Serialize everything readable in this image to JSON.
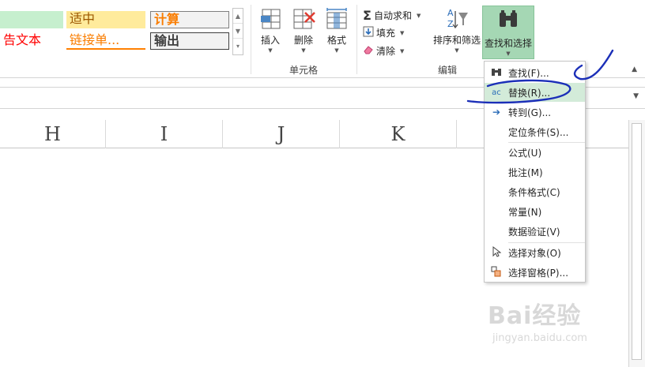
{
  "styles": {
    "neutral": "适中",
    "calculation": "计算",
    "warning": "告文本",
    "hyperlink": "链接单...",
    "output": "输出"
  },
  "cells_group": {
    "label": "单元格",
    "insert": "插入",
    "delete": "删除",
    "format": "格式"
  },
  "editing_group": {
    "label": "编辑",
    "autosum": "自动求和",
    "fill": "填充",
    "clear": "清除",
    "sort_filter": "排序和筛选",
    "find_select": "查找和选择"
  },
  "columns": [
    "H",
    "I",
    "J",
    "K"
  ],
  "find_menu": {
    "items": [
      {
        "label": "查找(F)...",
        "icon": "binoculars-icon"
      },
      {
        "label": "替换(R)...",
        "icon": "replace-icon"
      },
      {
        "label": "转到(G)...",
        "icon": "arrow-right-icon"
      },
      {
        "label": "定位条件(S)...",
        "icon": ""
      },
      {
        "label": "公式(U)",
        "icon": ""
      },
      {
        "label": "批注(M)",
        "icon": ""
      },
      {
        "label": "条件格式(C)",
        "icon": ""
      },
      {
        "label": "常量(N)",
        "icon": ""
      },
      {
        "label": "数据验证(V)",
        "icon": ""
      },
      {
        "label": "选择对象(O)",
        "icon": "pointer-icon"
      },
      {
        "label": "选择窗格(P)...",
        "icon": "selection-pane-icon"
      }
    ],
    "highlighted_index": 1
  },
  "watermark": {
    "logo": "Bai经验",
    "url": "jingyan.baidu.com"
  },
  "colors": {
    "accent_green": "#a5d7b4",
    "highlight": "#d3ebd9",
    "annotation": "#1b2fb8"
  }
}
